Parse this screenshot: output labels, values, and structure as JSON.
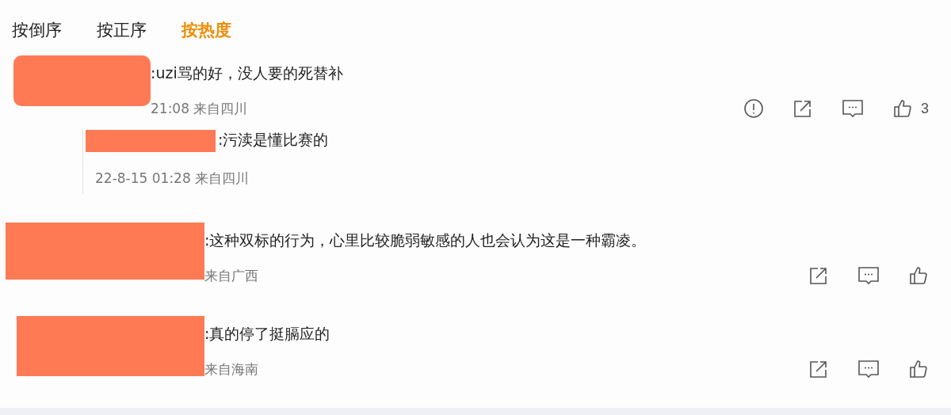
{
  "sort_tabs": [
    {
      "label": "按倒序",
      "selected": false
    },
    {
      "label": "按正序",
      "selected": false
    },
    {
      "label": "按热度",
      "selected": true
    }
  ],
  "comments": [
    {
      "redacted": true,
      "text": ":uzi骂的好，没人要的死替补",
      "meta": "21:08 来自四川",
      "actions": [
        {
          "kind": "report"
        },
        {
          "kind": "share"
        },
        {
          "kind": "comment"
        },
        {
          "kind": "like",
          "count": "3"
        }
      ],
      "replies": [
        {
          "redacted": true,
          "text": ":污渎是懂比赛的",
          "meta": "22-8-15 01:28 来自四川"
        }
      ]
    },
    {
      "redacted": true,
      "text": ":这种双标的行为，心里比较脆弱敏感的人也会认为这是一种霸凌。",
      "meta": "来自广西",
      "actions": [
        {
          "kind": "share"
        },
        {
          "kind": "comment"
        },
        {
          "kind": "like"
        }
      ]
    },
    {
      "redacted": true,
      "text": ":真的停了挺膈应的",
      "meta": "来自海南",
      "actions": [
        {
          "kind": "share"
        },
        {
          "kind": "comment"
        },
        {
          "kind": "like"
        }
      ]
    }
  ]
}
